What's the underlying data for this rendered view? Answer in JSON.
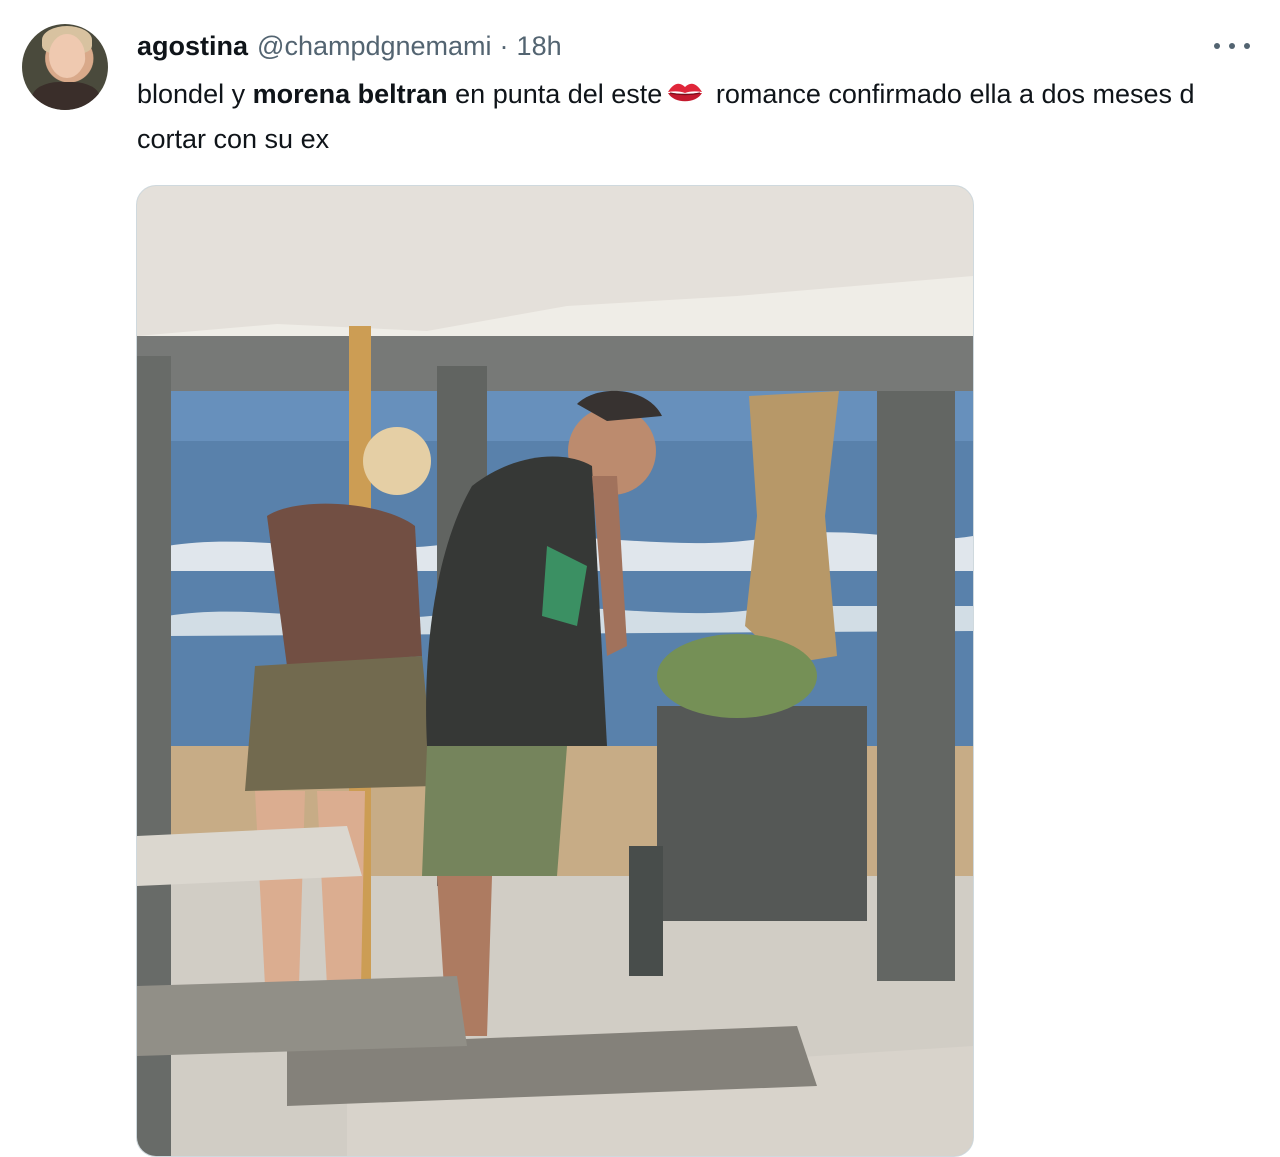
{
  "author": {
    "display_name": "agostina",
    "handle": "@champdgnemami",
    "separator": "·",
    "timestamp": "18h"
  },
  "tweet": {
    "text_part1": "blondel y ",
    "mention_bold": "morena beltran",
    "text_part2": " en punta del este",
    "emoji": "kiss-mark",
    "text_part3": " romance confirmado ella a dos meses d cortar con su ex"
  },
  "icons": {
    "more": "more-horizontal-icon",
    "kiss": "kiss-mark-icon"
  },
  "colors": {
    "text_primary": "#0f1419",
    "text_secondary": "#536471",
    "kiss_red": "#e0263a"
  }
}
